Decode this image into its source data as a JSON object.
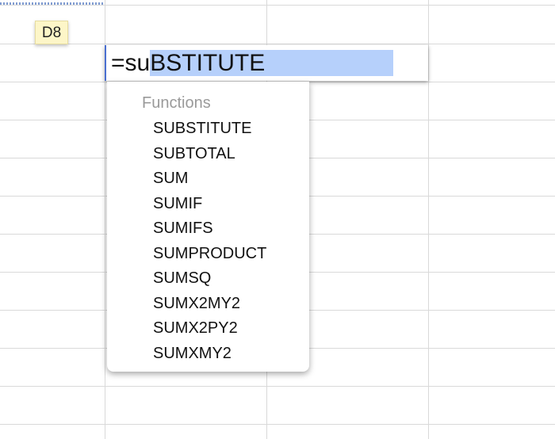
{
  "spreadsheet": {
    "cell_reference": "D8",
    "editor": {
      "typed_text": "=su",
      "completion_text": "BSTITUTE"
    }
  },
  "autocomplete": {
    "header": "Functions",
    "items": [
      "SUBSTITUTE",
      "SUBTOTAL",
      "SUM",
      "SUMIF",
      "SUMIFS",
      "SUMPRODUCT",
      "SUMSQ",
      "SUMX2MY2",
      "SUMX2PY2",
      "SUMXMY2"
    ]
  },
  "colors": {
    "selection_highlight": "#b6d0fb",
    "cursor_border": "#4a6fd0",
    "tooltip_background": "#fdf6c8",
    "gridline": "#d9d9d9"
  }
}
